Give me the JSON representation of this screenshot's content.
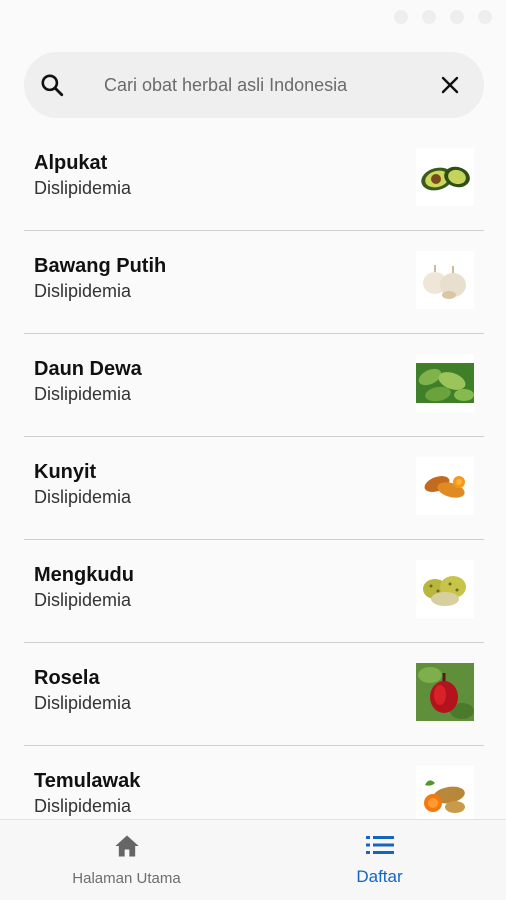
{
  "search": {
    "placeholder": "Cari obat herbal asli Indonesia",
    "value": ""
  },
  "items": [
    {
      "name": "Alpukat",
      "category": "Dislipidemia",
      "icon": "avocado-image"
    },
    {
      "name": "Bawang Putih",
      "category": "Dislipidemia",
      "icon": "garlic-image"
    },
    {
      "name": "Daun Dewa",
      "category": "Dislipidemia",
      "icon": "leaf-image"
    },
    {
      "name": "Kunyit",
      "category": "Dislipidemia",
      "icon": "turmeric-image"
    },
    {
      "name": "Mengkudu",
      "category": "Dislipidemia",
      "icon": "noni-image"
    },
    {
      "name": "Rosela",
      "category": "Dislipidemia",
      "icon": "roselle-image"
    },
    {
      "name": "Temulawak",
      "category": "Dislipidemia",
      "icon": "temulawak-image"
    }
  ],
  "nav": {
    "home_label": "Halaman Utama",
    "list_label": "Daftar"
  },
  "colors": {
    "accent": "#1565c0",
    "inactive": "#6e6e6e",
    "divider": "#cfcfcf",
    "search_bg": "#efefef"
  }
}
